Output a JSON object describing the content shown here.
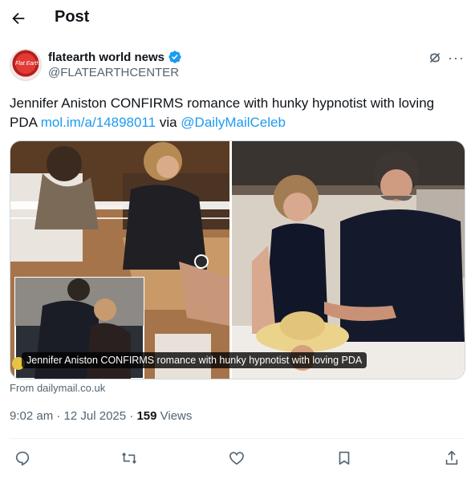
{
  "header": {
    "title": "Post"
  },
  "author": {
    "display_name": "flatearth world news",
    "handle": "@FLATEARTHCENTER"
  },
  "tweet": {
    "text_main": "Jennifer Aniston CONFIRMS romance with hunky hypnotist with loving PDA ",
    "link": "mol.im/a/14898011",
    "text_via": " via ",
    "mention": "@DailyMailCeleb"
  },
  "media": {
    "caption": "Jennifer Aniston CONFIRMS romance with hunky hypnotist with loving PDA",
    "source": "From dailymail.co.uk"
  },
  "meta": {
    "timestamp": "9:02 am · 12 Jul 2025 · ",
    "views_count": "159",
    "views_label": " Views"
  },
  "icons": {
    "back": "arrow-left-icon",
    "verified": "verified-badge-icon",
    "grok": "grok-icon",
    "more": "more-icon",
    "reply": "reply-icon",
    "repost": "repost-icon",
    "like": "like-icon",
    "bookmark": "bookmark-icon",
    "share": "share-icon"
  },
  "colors": {
    "accent": "#1d9bf0",
    "text": "#0f1419",
    "secondary": "#536471"
  }
}
